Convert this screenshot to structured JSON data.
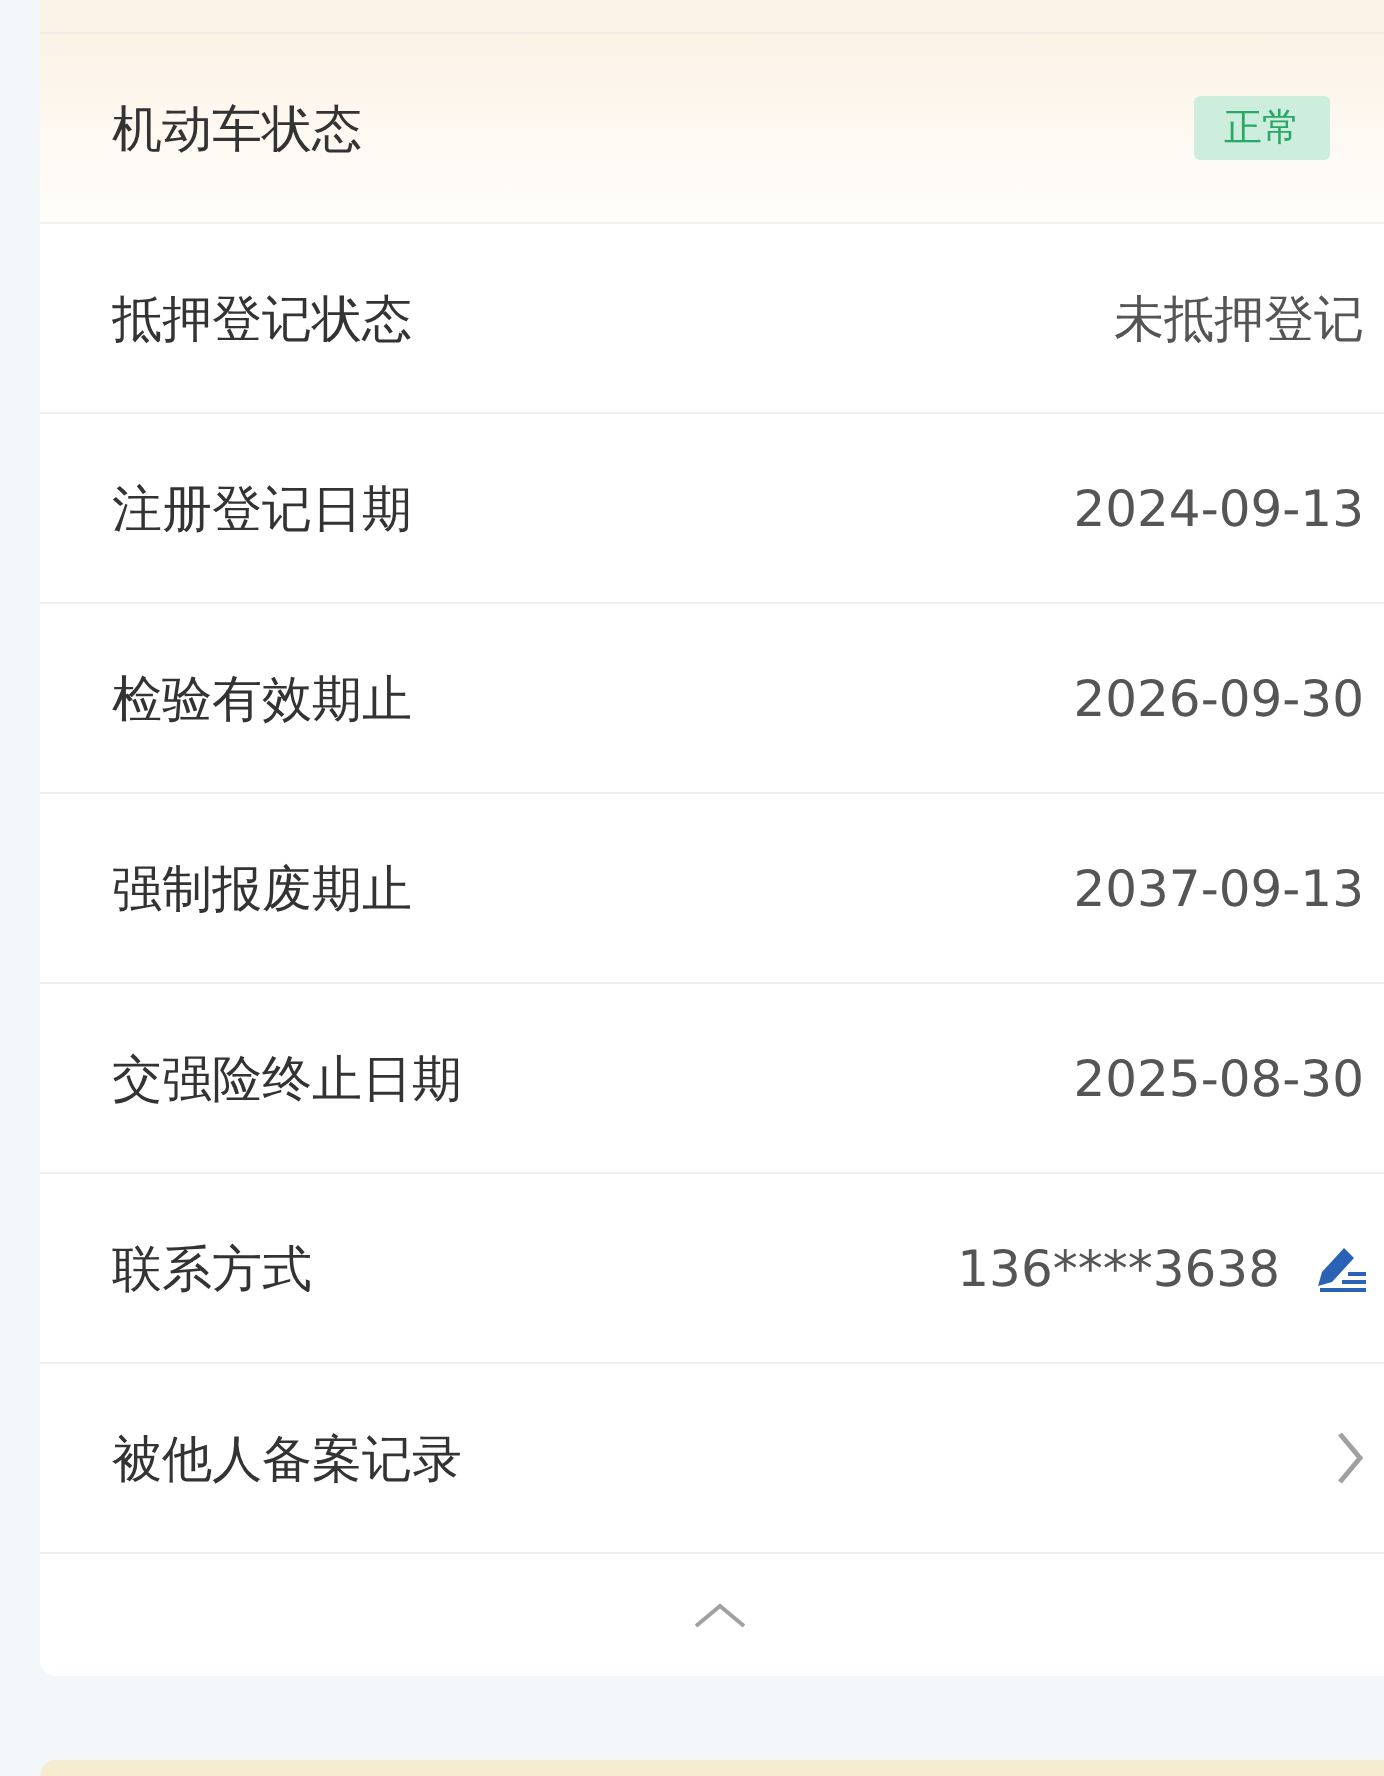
{
  "rows": [
    {
      "kind": "badge",
      "label": "机动车状态",
      "value": "正常"
    },
    {
      "kind": "text",
      "label": "抵押登记状态",
      "value": "未抵押登记"
    },
    {
      "kind": "text",
      "label": "注册登记日期",
      "value": "2024-09-13"
    },
    {
      "kind": "text",
      "label": "检验有效期止",
      "value": "2026-09-30"
    },
    {
      "kind": "text",
      "label": "强制报废期止",
      "value": "2037-09-13"
    },
    {
      "kind": "text",
      "label": "交强险终止日期",
      "value": "2025-08-30"
    },
    {
      "kind": "edit",
      "label": "联系方式",
      "value": "136****3638"
    },
    {
      "kind": "link",
      "label": "被他人备案记录"
    }
  ],
  "collapse": {
    "expanded": true
  }
}
